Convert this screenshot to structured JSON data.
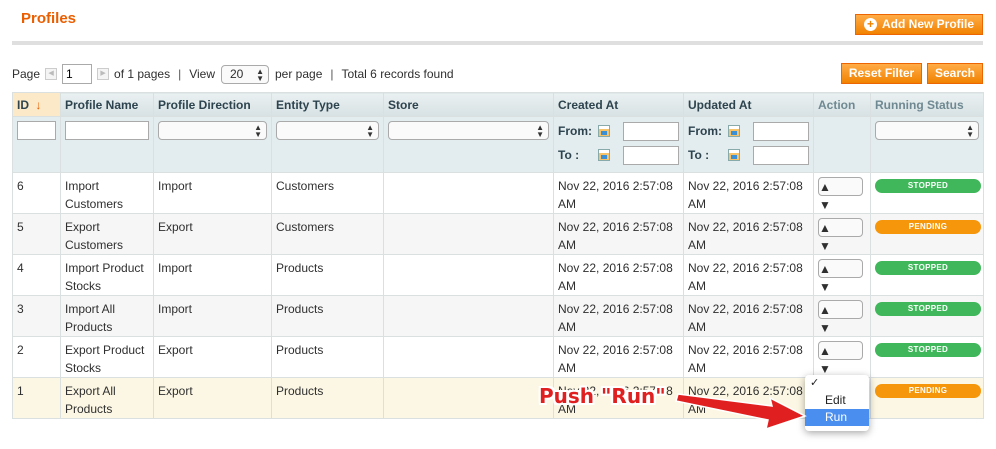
{
  "header": {
    "title": "Profiles",
    "add_button": "Add New Profile"
  },
  "pager": {
    "page_label": "Page",
    "page_value": "1",
    "of_pages": "of 1 pages",
    "sep": "|",
    "view_label": "View",
    "per_page_value": "20",
    "per_page_label": "per page",
    "total": "Total 6 records found"
  },
  "actions": {
    "reset": "Reset Filter",
    "search": "Search"
  },
  "columns": [
    "ID",
    "Profile Name",
    "Profile Direction",
    "Entity Type",
    "Store",
    "Created At",
    "Updated At",
    "Action",
    "Running Status"
  ],
  "sort_indicator": "↓",
  "filter": {
    "from_label": "From:",
    "to_label": "To :"
  },
  "rows": [
    {
      "id": "6",
      "name": "Import Customers",
      "direction": "Import",
      "entity": "Customers",
      "store": "",
      "created": "Nov 22, 2016 2:57:08 AM",
      "updated": "Nov 22, 2016 2:57:08 AM",
      "status": "STOPPED"
    },
    {
      "id": "5",
      "name": "Export Customers",
      "direction": "Export",
      "entity": "Customers",
      "store": "",
      "created": "Nov 22, 2016 2:57:08 AM",
      "updated": "Nov 22, 2016 2:57:08 AM",
      "status": "PENDING"
    },
    {
      "id": "4",
      "name": "Import Product Stocks",
      "direction": "Import",
      "entity": "Products",
      "store": "",
      "created": "Nov 22, 2016 2:57:08 AM",
      "updated": "Nov 22, 2016 2:57:08 AM",
      "status": "STOPPED"
    },
    {
      "id": "3",
      "name": "Import All Products",
      "direction": "Import",
      "entity": "Products",
      "store": "",
      "created": "Nov 22, 2016 2:57:08 AM",
      "updated": "Nov 22, 2016 2:57:08 AM",
      "status": "STOPPED"
    },
    {
      "id": "2",
      "name": "Export Product Stocks",
      "direction": "Export",
      "entity": "Products",
      "store": "",
      "created": "Nov 22, 2016 2:57:08 AM",
      "updated": "Nov 22, 2016 2:57:08 AM",
      "status": "STOPPED"
    },
    {
      "id": "1",
      "name": "Export All Products",
      "direction": "Export",
      "entity": "Products",
      "store": "",
      "created": "Nov 22, 2016 2:57:08 AM",
      "updated": "Nov 22, 2016 2:57:08 AM",
      "status": "PENDING"
    }
  ],
  "action_menu": {
    "checkmark": "✓",
    "options": [
      "Edit",
      "Run"
    ],
    "highlighted": "Run"
  },
  "annotation": "Push \"Run\"",
  "colors": {
    "accent": "#eb5e00",
    "button": "#f18200",
    "stopped": "#3fb75a",
    "pending": "#f5960b",
    "annotation": "#e02020",
    "menu_highlight": "#4a8ef0"
  }
}
